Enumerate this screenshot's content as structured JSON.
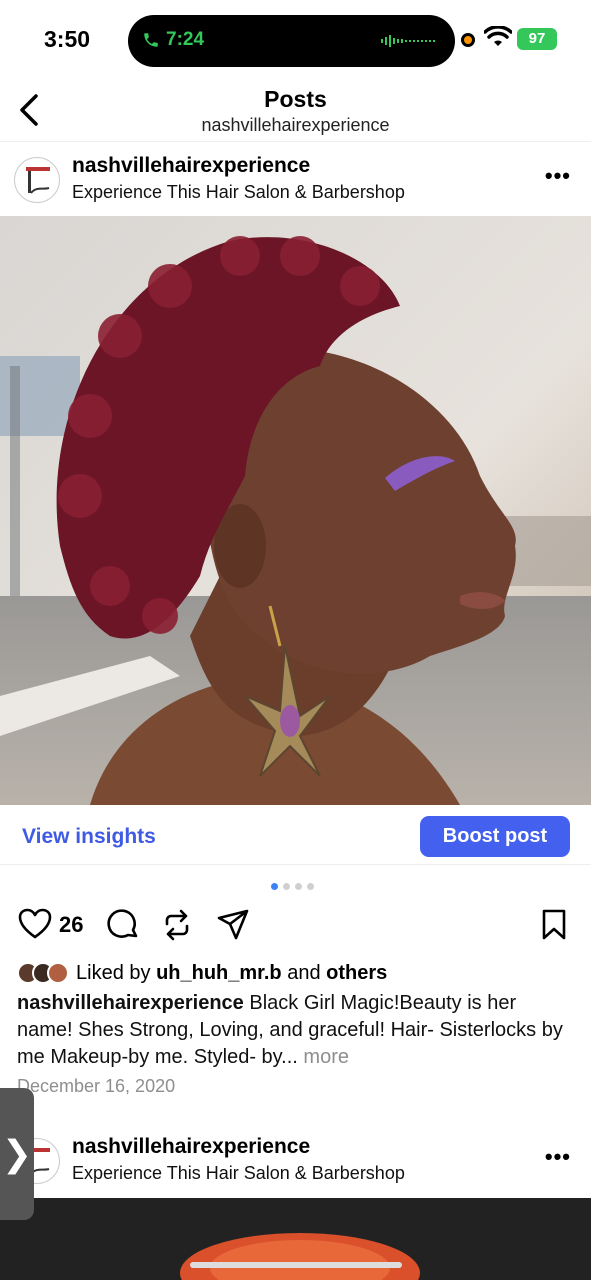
{
  "status_bar": {
    "time": "3:50",
    "call_time": "7:24",
    "battery": "97"
  },
  "header": {
    "title": "Posts",
    "subtitle": "nashvillehairexperience"
  },
  "post": {
    "username": "nashvillehairexperience",
    "location": "Experience This Hair Salon & Barbershop",
    "more_label": "•••",
    "view_insights": "View insights",
    "boost": "Boost post",
    "like_count": "26",
    "liked_by_prefix": "Liked by",
    "liked_by_user": "uh_huh_mr.b",
    "liked_by_and": "and",
    "liked_by_others": "others",
    "caption_user": "nashvillehairexperience",
    "caption_text": " Black Girl Magic!Beauty is her name! Shes Strong, Loving, and graceful!  Hair- Sisterlocks by me  Makeup-by me.  Styled- by...",
    "caption_more": "more",
    "date": "December 16, 2020"
  },
  "next_post": {
    "username": "nashvillehairexperience",
    "location": "Experience This Hair Salon & Barbershop",
    "more_label": "•••"
  },
  "side_tab_glyph": "❯",
  "colors": {
    "accent": "#4361ee",
    "link": "#3f5be3",
    "call_green": "#34c759",
    "battery_green": "#34c759"
  }
}
